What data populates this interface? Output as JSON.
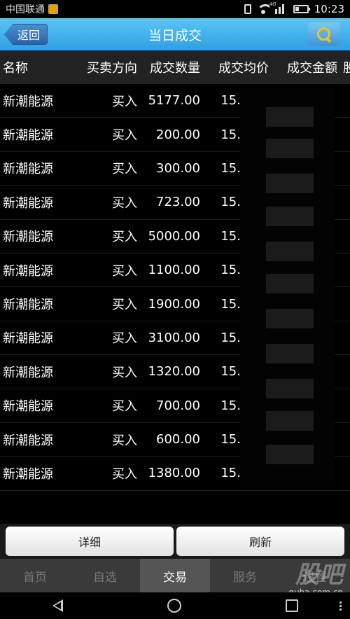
{
  "status_bar": {
    "carrier": "中国联通",
    "network_badge": "4G",
    "time": "10:23"
  },
  "header": {
    "back_label": "返回",
    "title": "当日成交",
    "search_icon": "search-icon"
  },
  "table": {
    "columns": [
      "名称",
      "买卖方向",
      "成交数量",
      "成交均价",
      "成交金额",
      "股"
    ],
    "rows": [
      {
        "name": "新潮能源",
        "direction": "买入",
        "quantity": "5177.00",
        "price": "15."
      },
      {
        "name": "新潮能源",
        "direction": "买入",
        "quantity": "200.00",
        "price": "15."
      },
      {
        "name": "新潮能源",
        "direction": "买入",
        "quantity": "300.00",
        "price": "15."
      },
      {
        "name": "新潮能源",
        "direction": "买入",
        "quantity": "723.00",
        "price": "15."
      },
      {
        "name": "新潮能源",
        "direction": "买入",
        "quantity": "5000.00",
        "price": "15."
      },
      {
        "name": "新潮能源",
        "direction": "买入",
        "quantity": "1100.00",
        "price": "15."
      },
      {
        "name": "新潮能源",
        "direction": "买入",
        "quantity": "1900.00",
        "price": "15."
      },
      {
        "name": "新潮能源",
        "direction": "买入",
        "quantity": "3100.00",
        "price": "15."
      },
      {
        "name": "新潮能源",
        "direction": "买入",
        "quantity": "1320.00",
        "price": "15."
      },
      {
        "name": "新潮能源",
        "direction": "买入",
        "quantity": "700.00",
        "price": "15."
      },
      {
        "name": "新潮能源",
        "direction": "买入",
        "quantity": "600.00",
        "price": "15."
      },
      {
        "name": "新潮能源",
        "direction": "买入",
        "quantity": "1380.00",
        "price": "15."
      }
    ]
  },
  "actions": {
    "detail_label": "详细",
    "refresh_label": "刷新"
  },
  "tabs": [
    {
      "label": "首页",
      "active": false
    },
    {
      "label": "自选",
      "active": false
    },
    {
      "label": "交易",
      "active": true
    },
    {
      "label": "服务",
      "active": false
    },
    {
      "label": "设置",
      "active": false
    }
  ],
  "watermark": {
    "big": "股吧",
    "small": "guba.com.cn"
  },
  "colors": {
    "title_bar": "#2f9fe3",
    "search_icon": "#f4c21a",
    "active_tab": "#555555"
  }
}
